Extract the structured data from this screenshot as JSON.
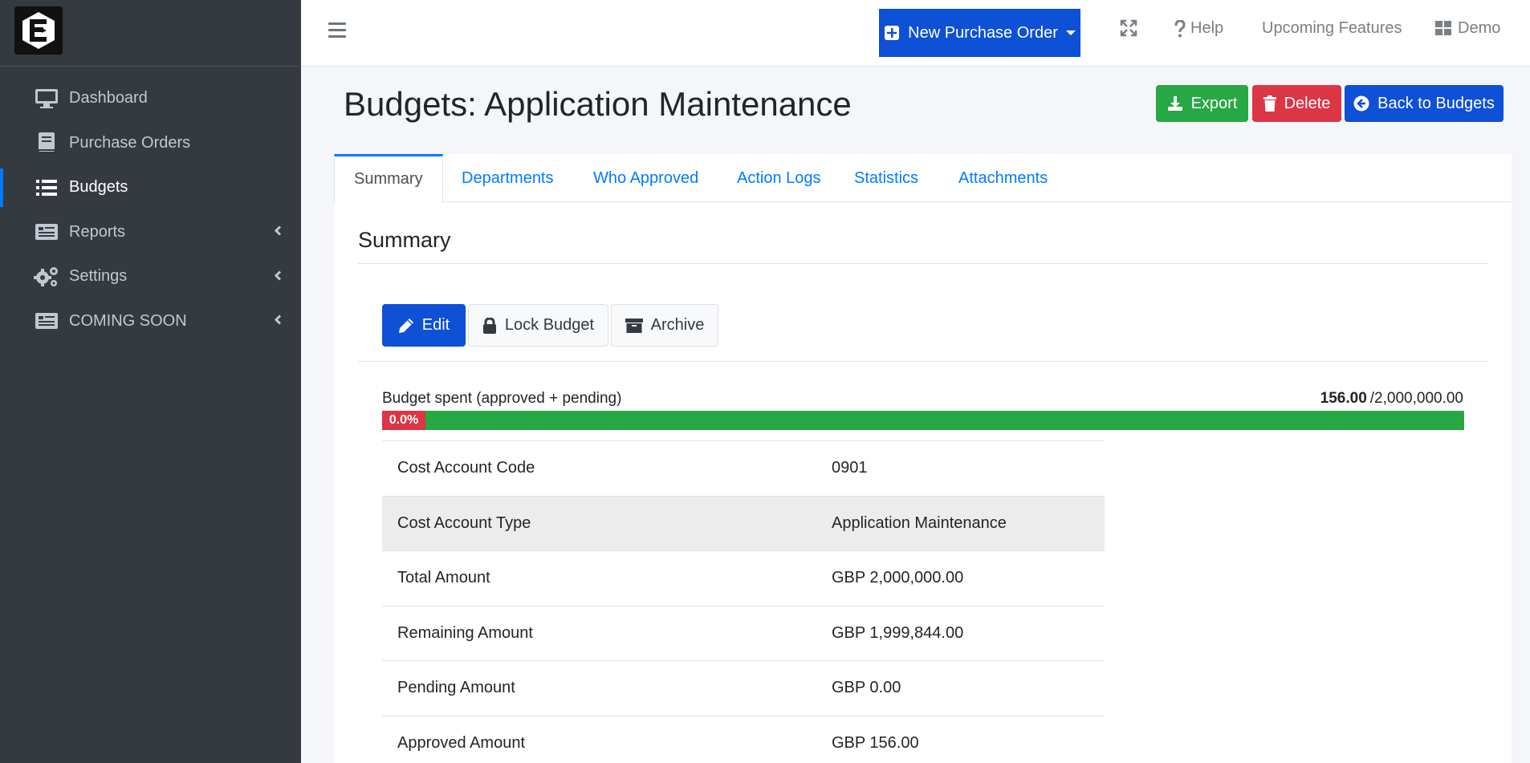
{
  "sidebar": {
    "items": [
      {
        "label": "Dashboard",
        "icon": "desktop-icon"
      },
      {
        "label": "Purchase Orders",
        "icon": "book-icon"
      },
      {
        "label": "Budgets",
        "icon": "list-icon",
        "active": true
      },
      {
        "label": "Reports",
        "icon": "report-icon",
        "has_submenu": true
      },
      {
        "label": "Settings",
        "icon": "cogs-icon",
        "has_submenu": true
      },
      {
        "label": "COMING SOON",
        "icon": "report-icon",
        "has_submenu": true
      }
    ]
  },
  "topbar": {
    "new_po_label": "New Purchase Order",
    "help_label": "Help",
    "upcoming_label": "Upcoming Features",
    "demo_label": "Demo"
  },
  "header": {
    "title": "Budgets: Application Maintenance",
    "export_label": "Export",
    "delete_label": "Delete",
    "back_label": "Back to Budgets"
  },
  "tabs": [
    {
      "label": "Summary",
      "active": true
    },
    {
      "label": "Departments"
    },
    {
      "label": "Who Approved"
    },
    {
      "label": "Action Logs"
    },
    {
      "label": "Statistics"
    },
    {
      "label": "Attachments"
    }
  ],
  "summary": {
    "title": "Summary",
    "edit_label": "Edit",
    "lock_label": "Lock Budget",
    "archive_label": "Archive",
    "budget_spent_label": "Budget spent (approved + pending)",
    "spent": "156.00",
    "total": "/2,000,000.00",
    "progress_label": "0.0%",
    "progress_fraction": 7.8e-05,
    "rows": [
      {
        "key": "Cost Account Code",
        "value": "0901"
      },
      {
        "key": "Cost Account Type",
        "value": "Application Maintenance"
      },
      {
        "key": "Total Amount",
        "value": "GBP 2,000,000.00"
      },
      {
        "key": "Remaining Amount",
        "value": "GBP 1,999,844.00"
      },
      {
        "key": "Pending Amount",
        "value": "GBP 0.00"
      },
      {
        "key": "Approved Amount",
        "value": "GBP 156.00"
      }
    ]
  },
  "colors": {
    "primary": "#0e50d6",
    "success": "#28a745",
    "danger": "#dc3545",
    "sidebar": "#343a40"
  }
}
